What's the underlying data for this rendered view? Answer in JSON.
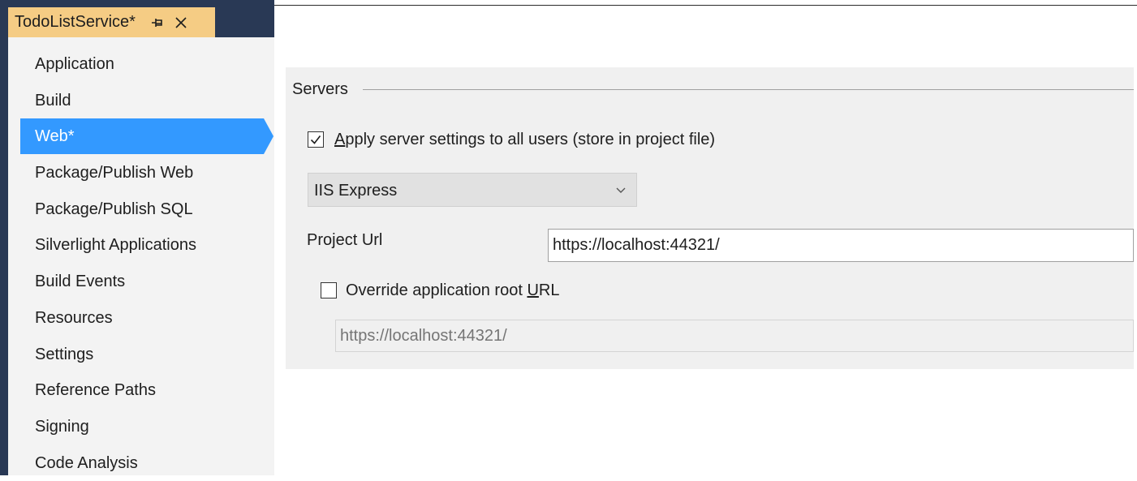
{
  "tab": {
    "title": "TodoListService*",
    "pin_icon": "pin-icon",
    "close_icon": "close-icon"
  },
  "sidebar": {
    "items": [
      {
        "label": "Application",
        "selected": false
      },
      {
        "label": "Build",
        "selected": false
      },
      {
        "label": "Web*",
        "selected": true
      },
      {
        "label": "Package/Publish Web",
        "selected": false
      },
      {
        "label": "Package/Publish SQL",
        "selected": false
      },
      {
        "label": "Silverlight Applications",
        "selected": false
      },
      {
        "label": "Build Events",
        "selected": false
      },
      {
        "label": "Resources",
        "selected": false
      },
      {
        "label": "Settings",
        "selected": false
      },
      {
        "label": "Reference Paths",
        "selected": false
      },
      {
        "label": "Signing",
        "selected": false
      },
      {
        "label": "Code Analysis",
        "selected": false
      }
    ]
  },
  "servers": {
    "group_title": "Servers",
    "apply_all_users": {
      "label_accel": "A",
      "label_rest": "pply server settings to all users (store in project file)",
      "checked": true
    },
    "server_select": {
      "value": "IIS Express",
      "icon": "chevron-down-icon"
    },
    "project_url": {
      "label_pre": "Pro",
      "label_accel": "j",
      "label_post": "ect Url",
      "value": "https://localhost:44321/"
    },
    "override_root": {
      "label_pre": "Override application root ",
      "label_accel": "U",
      "label_post": "RL",
      "checked": false,
      "placeholder": "https://localhost:44321/"
    }
  },
  "colors": {
    "accent": "#3399ff",
    "tab_active": "#f5cc84",
    "chrome_dark": "#293955",
    "panel": "#f0f0f0",
    "sidebar": "#f3f3f3"
  }
}
